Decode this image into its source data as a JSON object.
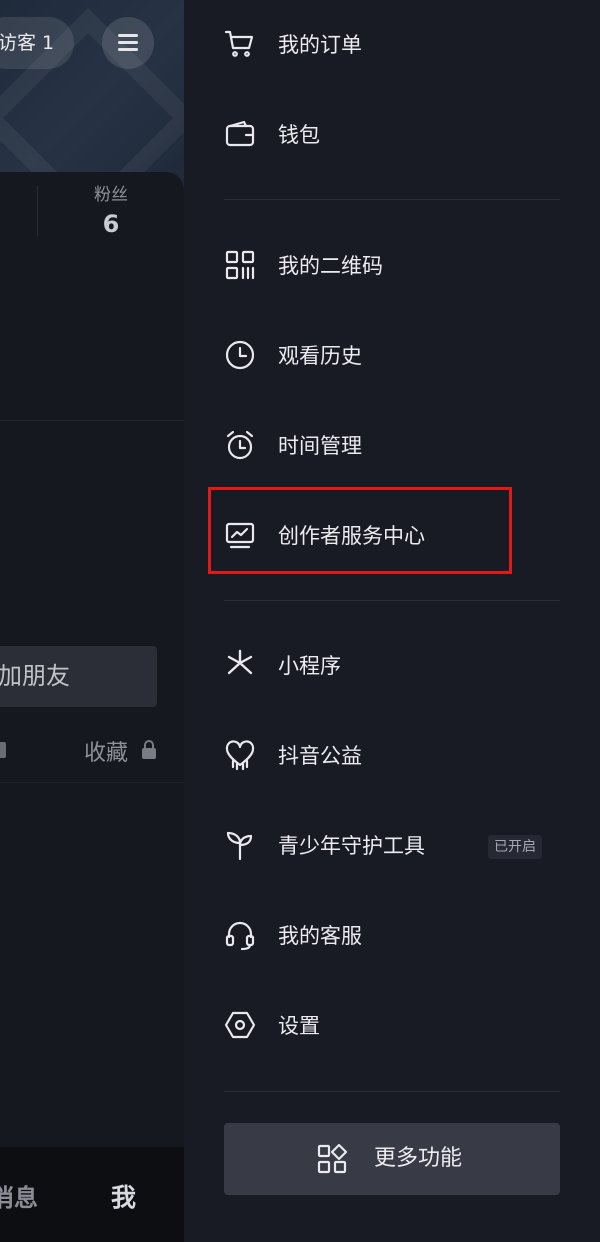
{
  "left_page": {
    "visitor_chip": "访客 1",
    "fans_label": "粉丝",
    "fans_count": "6",
    "add_friend_label": "加朋友",
    "collect_tab_label": "收藏",
    "bottom_nav": {
      "messages_label": "消息",
      "me_label": "我"
    }
  },
  "drawer": {
    "group1": [
      {
        "label": "我的订单",
        "icon": "cart-icon"
      },
      {
        "label": "钱包",
        "icon": "wallet-icon"
      }
    ],
    "group2": [
      {
        "label": "我的二维码",
        "icon": "qrcode-icon"
      },
      {
        "label": "观看历史",
        "icon": "clock-icon"
      },
      {
        "label": "时间管理",
        "icon": "alarm-icon"
      },
      {
        "label": "创作者服务中心",
        "icon": "creator-monitor-icon",
        "highlighted": true
      }
    ],
    "group3": [
      {
        "label": "小程序",
        "icon": "mini-program-icon"
      },
      {
        "label": "抖音公益",
        "icon": "charity-heart-icon"
      },
      {
        "label": "青少年守护工具",
        "icon": "sprout-icon",
        "badge": "已开启"
      },
      {
        "label": "我的客服",
        "icon": "headset-icon"
      },
      {
        "label": "设置",
        "icon": "settings-icon"
      }
    ],
    "more_button_label": "更多功能",
    "highlight_color": "#e01a1a"
  }
}
